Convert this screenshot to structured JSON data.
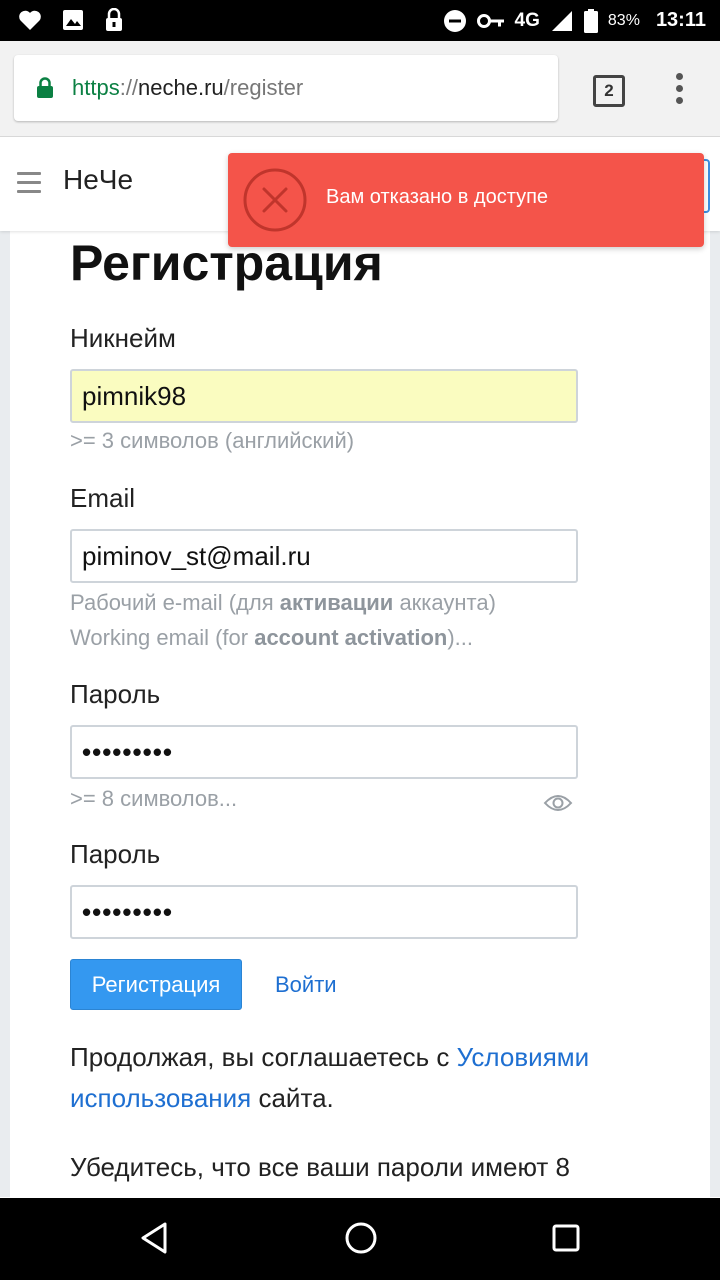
{
  "status_bar": {
    "network": "4G",
    "battery_percent": "83%",
    "time": "13:11"
  },
  "browser": {
    "url_scheme": "https",
    "url_separator": "://",
    "url_host": "neche.ru",
    "url_path": "/register",
    "tab_count": "2"
  },
  "site": {
    "brand": "НеЧе"
  },
  "toast": {
    "message": "Вам отказано в доступе",
    "color": "#f4544a"
  },
  "form": {
    "title": "Регистрация",
    "nickname": {
      "label": "Никнейм",
      "value": "pimnik98",
      "hint": ">= 3 символов (английский)"
    },
    "email": {
      "label": "Email",
      "value": "piminov_st@mail.ru",
      "hint_ru_prefix": "Рабочий e-mail (для ",
      "hint_ru_bold": "активации",
      "hint_ru_suffix": " аккаунта)",
      "hint_en_prefix": "Working email (for ",
      "hint_en_bold": "account activation",
      "hint_en_suffix": ")..."
    },
    "password": {
      "label": "Пароль",
      "value_masked": "•••••••••",
      "hint": ">= 8 символов..."
    },
    "password_confirm": {
      "label": "Пароль",
      "value_masked": "•••••••••"
    },
    "register_button": "Регистрация",
    "login_link": "Войти",
    "terms_prefix": "Продолжая, вы соглашаетесь с ",
    "terms_link": "Условиями использования",
    "terms_suffix": " сайта.",
    "note": "Убедитесь, что все ваши пароли имеют 8"
  },
  "colors": {
    "accent": "#3498f0",
    "link": "#1e6fd1",
    "autofill": "#fafcc0"
  }
}
